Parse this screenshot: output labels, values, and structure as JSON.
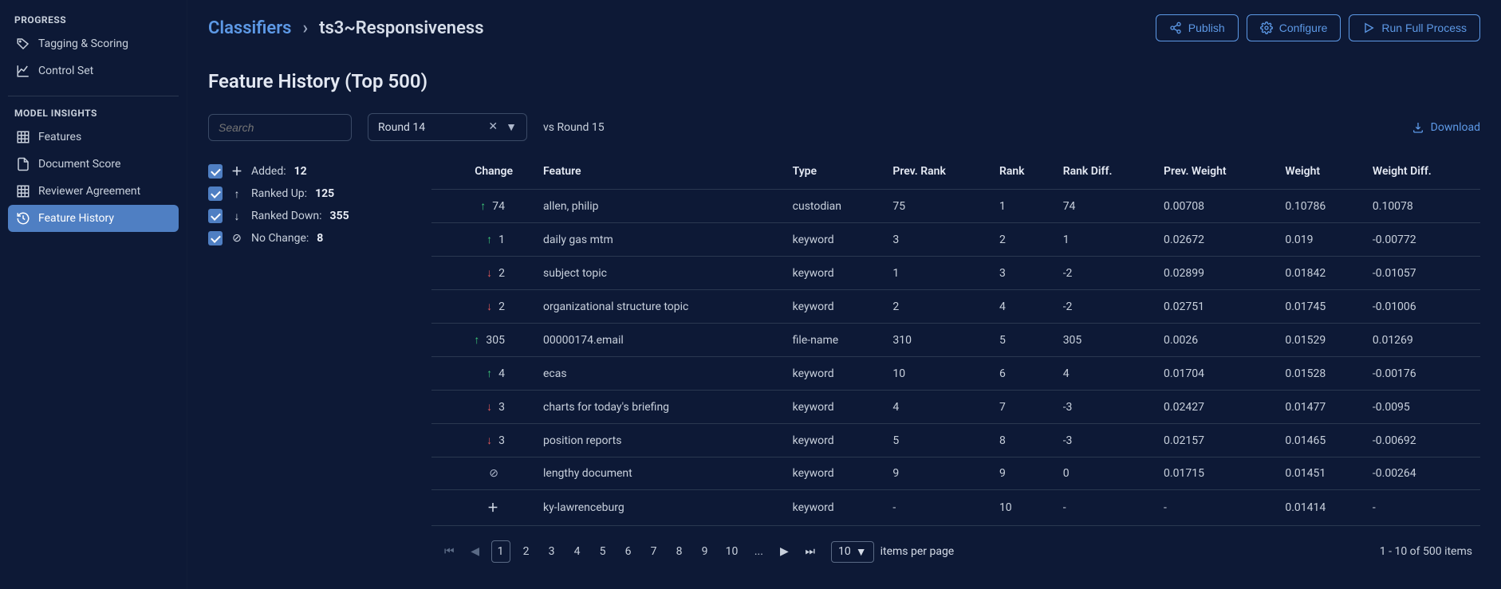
{
  "sidebar": {
    "section_progress": "PROGRESS",
    "section_model": "MODEL INSIGHTS",
    "items": {
      "tagging": "Tagging & Scoring",
      "control": "Control Set",
      "features": "Features",
      "docscore": "Document Score",
      "reviewer": "Reviewer Agreement",
      "feathist": "Feature History"
    }
  },
  "breadcrumb": {
    "parent": "Classifiers",
    "current": "ts3~Responsiveness"
  },
  "actions": {
    "publish": "Publish",
    "configure": "Configure",
    "run": "Run Full Process",
    "download": "Download"
  },
  "page_title": "Feature History (Top 500)",
  "toolbar": {
    "search_placeholder": "Search",
    "round_label": "Round 14",
    "vs_label": "vs Round 15"
  },
  "filters": {
    "added_label": "Added:",
    "added_count": "12",
    "up_label": "Ranked Up:",
    "up_count": "125",
    "down_label": "Ranked Down:",
    "down_count": "355",
    "noch_label": "No Change:",
    "noch_count": "8"
  },
  "columns": {
    "change": "Change",
    "feature": "Feature",
    "type": "Type",
    "prev_rank": "Prev. Rank",
    "rank": "Rank",
    "rank_diff": "Rank Diff.",
    "prev_weight": "Prev. Weight",
    "weight": "Weight",
    "weight_diff": "Weight Diff."
  },
  "rows": [
    {
      "change_dir": "up",
      "change_val": "74",
      "feature": "allen, philip",
      "type": "custodian",
      "prev_rank": "75",
      "rank": "1",
      "rank_diff": "74",
      "prev_weight": "0.00708",
      "weight": "0.10786",
      "weight_diff": "0.10078"
    },
    {
      "change_dir": "up",
      "change_val": "1",
      "feature": "daily gas mtm",
      "type": "keyword",
      "prev_rank": "3",
      "rank": "2",
      "rank_diff": "1",
      "prev_weight": "0.02672",
      "weight": "0.019",
      "weight_diff": "-0.00772"
    },
    {
      "change_dir": "down",
      "change_val": "2",
      "feature": "subject topic",
      "type": "keyword",
      "prev_rank": "1",
      "rank": "3",
      "rank_diff": "-2",
      "prev_weight": "0.02899",
      "weight": "0.01842",
      "weight_diff": "-0.01057"
    },
    {
      "change_dir": "down",
      "change_val": "2",
      "feature": "organizational structure topic",
      "type": "keyword",
      "prev_rank": "2",
      "rank": "4",
      "rank_diff": "-2",
      "prev_weight": "0.02751",
      "weight": "0.01745",
      "weight_diff": "-0.01006"
    },
    {
      "change_dir": "up",
      "change_val": "305",
      "feature": "00000174.email",
      "type": "file-name",
      "prev_rank": "310",
      "rank": "5",
      "rank_diff": "305",
      "prev_weight": "0.0026",
      "weight": "0.01529",
      "weight_diff": "0.01269"
    },
    {
      "change_dir": "up",
      "change_val": "4",
      "feature": "ecas",
      "type": "keyword",
      "prev_rank": "10",
      "rank": "6",
      "rank_diff": "4",
      "prev_weight": "0.01704",
      "weight": "0.01528",
      "weight_diff": "-0.00176"
    },
    {
      "change_dir": "down",
      "change_val": "3",
      "feature": "charts for today's briefing",
      "type": "keyword",
      "prev_rank": "4",
      "rank": "7",
      "rank_diff": "-3",
      "prev_weight": "0.02427",
      "weight": "0.01477",
      "weight_diff": "-0.0095"
    },
    {
      "change_dir": "down",
      "change_val": "3",
      "feature": "position reports",
      "type": "keyword",
      "prev_rank": "5",
      "rank": "8",
      "rank_diff": "-3",
      "prev_weight": "0.02157",
      "weight": "0.01465",
      "weight_diff": "-0.00692"
    },
    {
      "change_dir": "nochange",
      "change_val": "",
      "feature": "lengthy document",
      "type": "keyword",
      "prev_rank": "9",
      "rank": "9",
      "rank_diff": "0",
      "prev_weight": "0.01715",
      "weight": "0.01451",
      "weight_diff": "-0.00264"
    },
    {
      "change_dir": "added",
      "change_val": "",
      "feature": "ky-lawrenceburg",
      "type": "keyword",
      "prev_rank": "-",
      "rank": "10",
      "rank_diff": "-",
      "prev_weight": "-",
      "weight": "0.01414",
      "weight_diff": "-"
    }
  ],
  "pagination": {
    "pages": [
      "1",
      "2",
      "3",
      "4",
      "5",
      "6",
      "7",
      "8",
      "9",
      "10"
    ],
    "more": "...",
    "page_size": "10",
    "per_label": "items per page",
    "summary": "1 - 10 of 500 items"
  }
}
